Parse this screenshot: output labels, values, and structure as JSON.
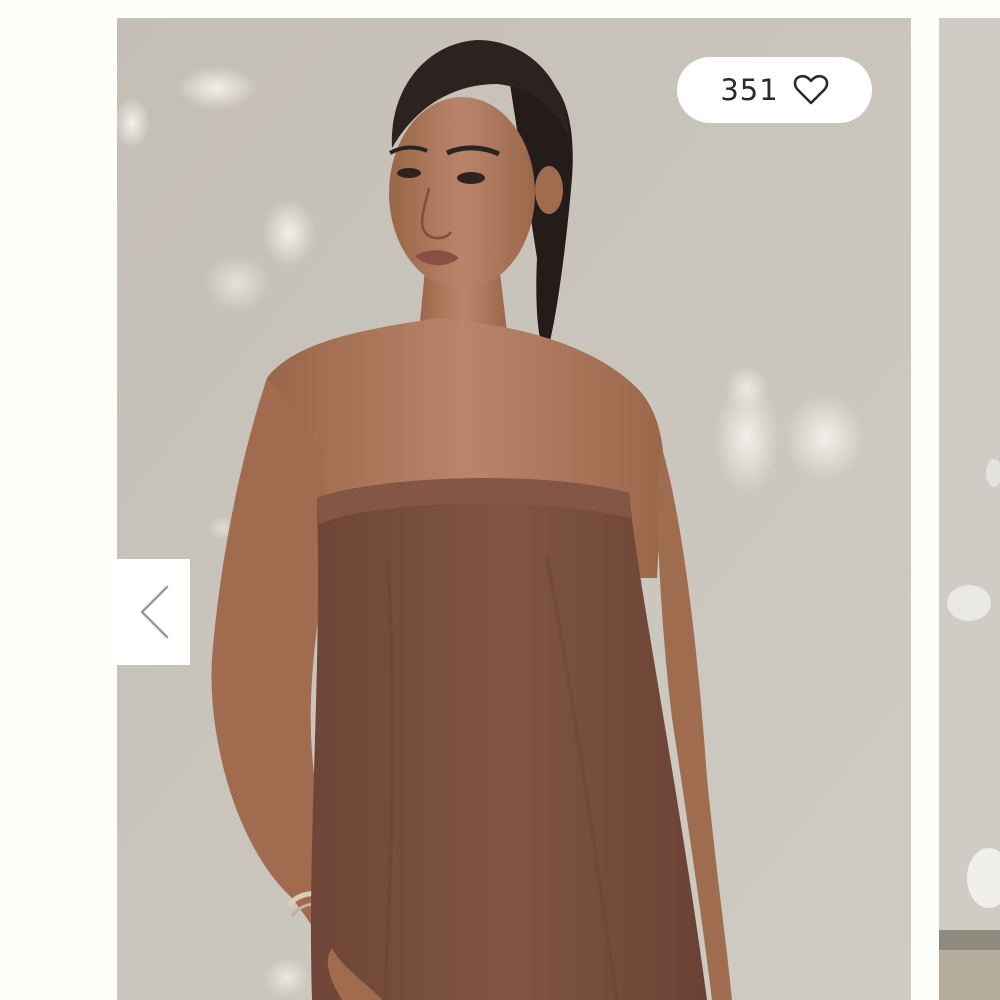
{
  "favorite": {
    "count": "351",
    "icon": "heart-outline-icon"
  },
  "navigation": {
    "previous_icon": "chevron-left-icon"
  },
  "colors": {
    "page_background": "#fdfdf9",
    "image_wall": "#c9c5bd",
    "dress": "#7a5040",
    "skin": "#b07a5c",
    "hair": "#2a2320",
    "pill_background": "#ffffff",
    "text": "#2b2b2b"
  }
}
